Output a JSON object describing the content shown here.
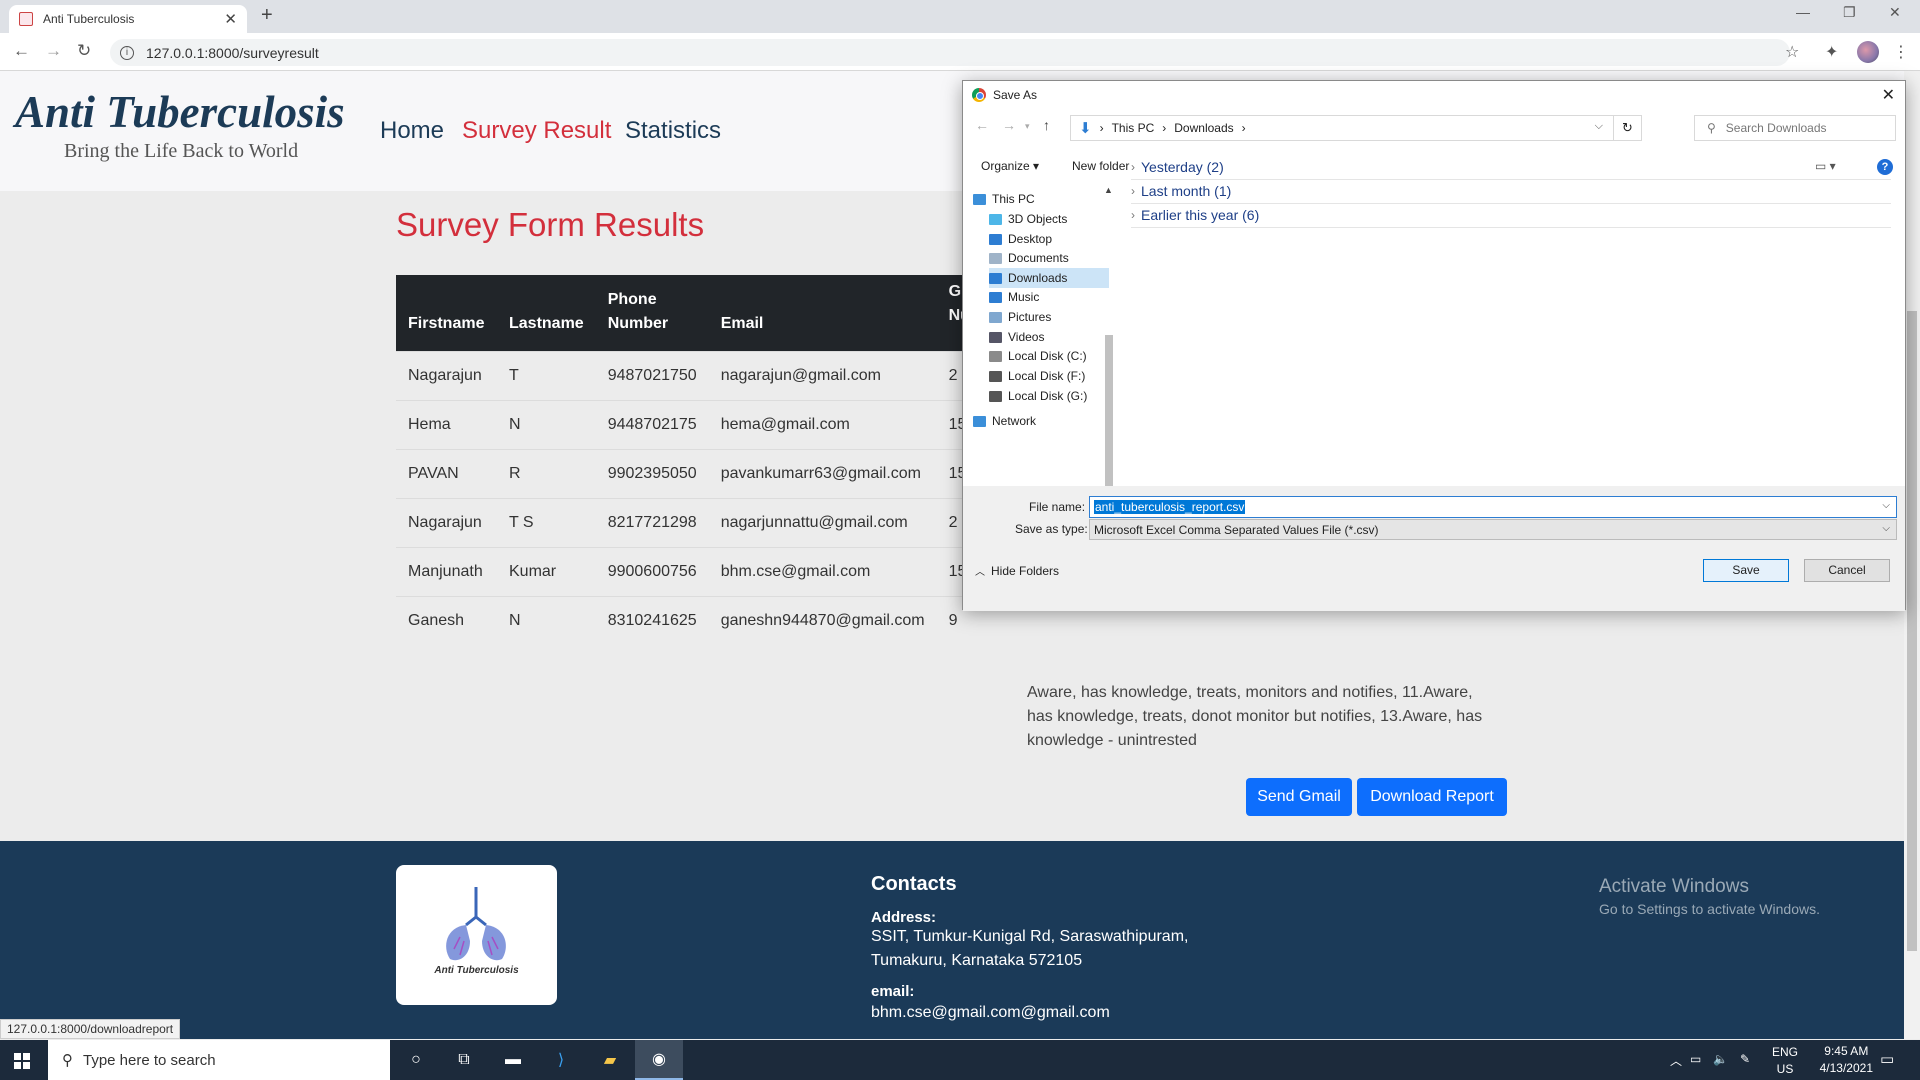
{
  "browser": {
    "tab_title": "Anti Tuberculosis",
    "tab_close": "✕",
    "new_tab": "+",
    "url": "127.0.0.1:8000/surveyresult",
    "status_url": "127.0.0.1:8000/downloadreport"
  },
  "site": {
    "brand_title": "Anti Tuberculosis",
    "brand_subtitle": "Bring the Life Back to World",
    "nav": [
      {
        "label": "Home"
      },
      {
        "label": "Survey Result"
      },
      {
        "label": "Statistics"
      }
    ],
    "active_nav": "Survey Result",
    "page_title": "Survey Form Results",
    "table": {
      "headers": [
        "Firstname",
        "Lastname",
        "Phone Number",
        "Email",
        "Gr Nu"
      ],
      "rows": [
        [
          "Nagarajun",
          "T",
          "9487021750",
          "nagarajun@gmail.com",
          "2"
        ],
        [
          "Hema",
          "N",
          "9448702175",
          "hema@gmail.com",
          "15"
        ],
        [
          "PAVAN",
          "R",
          "9902395050",
          "pavankumarr63@gmail.com",
          "15"
        ],
        [
          "Nagarajun",
          "T S",
          "8217721298",
          "nagarjunnattu@gmail.com",
          "2"
        ],
        [
          "Manjunath",
          "Kumar",
          "9900600756",
          "bhm.cse@gmail.com",
          "15"
        ],
        [
          "Ganesh",
          "N",
          "8310241625",
          "ganeshn944870@gmail.com",
          "9"
        ]
      ]
    },
    "aware_text": "Aware, has knowledge, treats, monitors and notifies, 11.Aware, has knowledge, treats, donot monitor but notifies, 13.Aware, has knowledge - unintrested",
    "send_gmail_label": "Send Gmail",
    "download_report_label": "Download Report",
    "footer": {
      "logo_text": "Anti Tuberculosis",
      "contacts_heading": "Contacts",
      "address_label": "Address:",
      "address_line1": "SSIT, Tumkur-Kunigal Rd, Saraswathipuram,",
      "address_line2": "Tumakuru, Karnataka 572105",
      "email_label": "email:",
      "email_value": "bhm.cse@gmail.com@gmail.com"
    },
    "activate_windows_title": "Activate Windows",
    "activate_windows_sub": "Go to Settings to activate Windows."
  },
  "dialog": {
    "title": "Save As",
    "path": [
      "This PC",
      "Downloads"
    ],
    "search_placeholder": "Search Downloads",
    "organize_label": "Organize ▾",
    "new_folder_label": "New folder",
    "tree": [
      {
        "label": "This PC",
        "icon": "pc-icon",
        "color": "#3b8fd9"
      },
      {
        "label": "3D Objects",
        "icon": "cube-icon",
        "color": "#4db6e8"
      },
      {
        "label": "Desktop",
        "icon": "desktop-icon",
        "color": "#2d7dd2"
      },
      {
        "label": "Documents",
        "icon": "document-icon",
        "color": "#9fb3c8"
      },
      {
        "label": "Downloads",
        "icon": "download-icon",
        "color": "#2d7dd2"
      },
      {
        "label": "Music",
        "icon": "music-icon",
        "color": "#2d7dd2"
      },
      {
        "label": "Pictures",
        "icon": "pictures-icon",
        "color": "#7fa7cf"
      },
      {
        "label": "Videos",
        "icon": "videos-icon",
        "color": "#556"
      },
      {
        "label": "Local Disk (C:)",
        "icon": "disk-icon",
        "color": "#8a8a8a"
      },
      {
        "label": "Local Disk (F:)",
        "icon": "disk-icon",
        "color": "#555"
      },
      {
        "label": "Local Disk (G:)",
        "icon": "disk-icon",
        "color": "#555"
      },
      {
        "label": "Network",
        "icon": "network-icon",
        "color": "#3b8fd9"
      }
    ],
    "selected_tree_item": "Downloads",
    "groups": [
      {
        "label": "Yesterday (2)"
      },
      {
        "label": "Last month (1)"
      },
      {
        "label": "Earlier this year (6)"
      }
    ],
    "file_name_label": "File name:",
    "file_name_value": "anti_tuberculosis_report.csv",
    "save_type_label": "Save as type:",
    "save_type_value": "Microsoft Excel Comma Separated Values File (*.csv)",
    "hide_folders_label": "Hide Folders",
    "save_label": "Save",
    "cancel_label": "Cancel"
  },
  "taskbar": {
    "search_placeholder": "Type here to search",
    "language": "ENG",
    "region": "US",
    "time": "9:45 AM",
    "date": "4/13/2021"
  }
}
